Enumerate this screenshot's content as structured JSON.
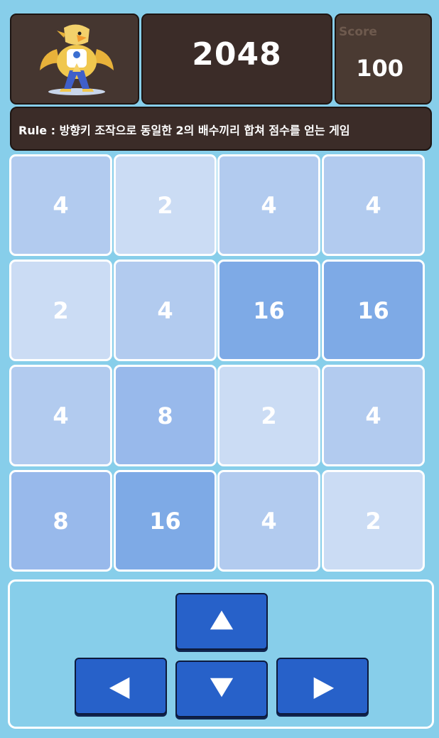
{
  "header": {
    "title": "2048",
    "score_label": "Score",
    "score_value": "100",
    "logo_icon": "eagle-mascot-icon"
  },
  "rule": {
    "text": "Rule : 방향키 조작으로 동일한 2의 배수끼리 합쳐 점수를 얻는 게임"
  },
  "board": {
    "rows": [
      [
        "4",
        "2",
        "4",
        "4"
      ],
      [
        "2",
        "4",
        "16",
        "16"
      ],
      [
        "4",
        "8",
        "2",
        "4"
      ],
      [
        "8",
        "16",
        "4",
        "2"
      ]
    ]
  },
  "controls": {
    "up_icon": "arrow-up-icon",
    "left_icon": "arrow-left-icon",
    "down_icon": "arrow-down-icon",
    "right_icon": "arrow-right-icon"
  },
  "colors": {
    "background": "#87ceea",
    "dark_panel": "#3b2c28",
    "tile_2": "#cbdcf4",
    "tile_4": "#b2cbef",
    "tile_8": "#98b9eb",
    "tile_16": "#7eaae6",
    "button": "#2761c9"
  }
}
